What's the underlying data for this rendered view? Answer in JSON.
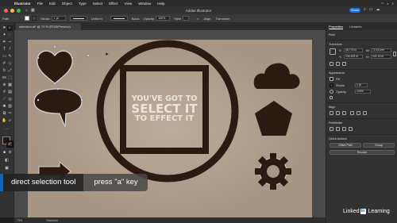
{
  "menubar": {
    "app_name": "Illustrator",
    "items": [
      "File",
      "Edit",
      "Object",
      "Type",
      "Select",
      "Effect",
      "View",
      "Window",
      "Help"
    ]
  },
  "appbar": {
    "title": "Adobe Illustrator",
    "share_label": "Share"
  },
  "control_bar": {
    "selection_label": "Path",
    "stroke_label": "Stroke",
    "stroke_weight": "1 pt",
    "profile": "Uniform",
    "brush": "Basic",
    "opacity_label": "Opacity",
    "opacity_value": "100%",
    "style_label": "Style",
    "align_label": "Align",
    "transform_label": "Transform"
  },
  "document": {
    "tab_label": "selection.ai* @ 73 % (RGB/Preview)",
    "zoom": "73%",
    "status_tool": "Selection"
  },
  "artwork": {
    "line1": "YOU'VE GOT TO",
    "line2": "SELECT IT",
    "line3": "TO EFFECT IT",
    "ink": "#2a1a12",
    "paper": "#a89684"
  },
  "overlay": {
    "left": "direct selection tool",
    "right": "press \"a\" key",
    "accent": "#0a66c2"
  },
  "panel": {
    "tabs": [
      "Properties",
      "Libraries"
    ],
    "path_title": "Path",
    "transform_title": "Transform",
    "x_label": "X:",
    "x_value": "36.775 in",
    "y_label": "Y:",
    "y_value": "134.625 in",
    "w_label": "W:",
    "w_value": "72.14 mm",
    "h_label": "H:",
    "h_value": "121.13 in",
    "appearance_title": "Appearance",
    "fill_label": "Fill",
    "stroke_label": "Stroke",
    "stroke_value": "1 pt",
    "opacity_label": "Opacity",
    "opacity_value": "100%",
    "align_title": "Align",
    "pathfinder_title": "Pathfinder",
    "quick_actions_title": "Quick Actions",
    "offset_path": "Offset Path",
    "group": "Group",
    "recolor": "Recolor"
  },
  "watermark": {
    "linked": "Linked",
    "in": "in",
    "learning": "Learning"
  }
}
